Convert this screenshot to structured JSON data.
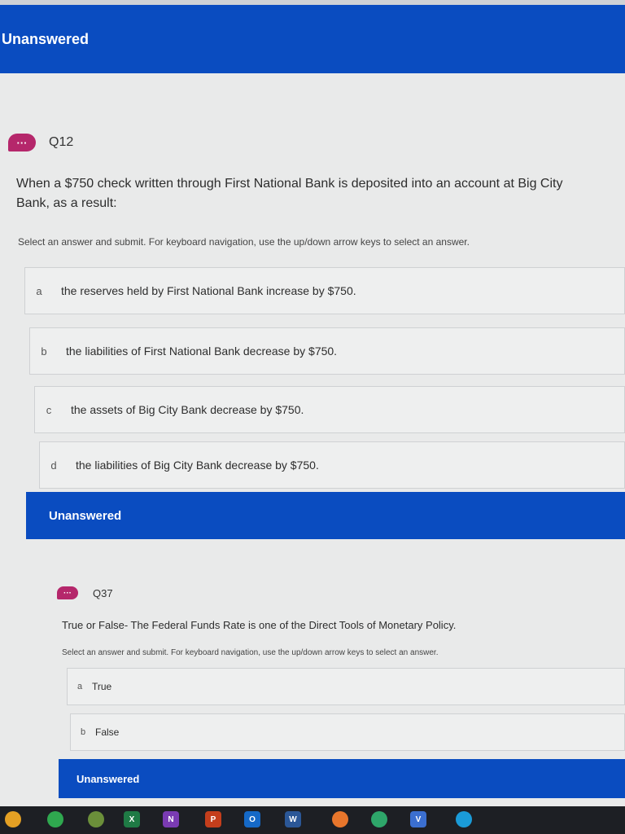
{
  "status": {
    "unanswered": "Unanswered"
  },
  "q12": {
    "number": "Q12",
    "badge": "···",
    "text": "When a $750 check written through First National Bank is deposited into an account at Big City Bank, as a result:",
    "instruction": "Select an answer and submit. For keyboard navigation, use the up/down arrow keys to select an answer.",
    "choices": [
      {
        "letter": "a",
        "text": "the reserves held by First National Bank increase by $750."
      },
      {
        "letter": "b",
        "text": "the liabilities of First National Bank decrease by $750."
      },
      {
        "letter": "c",
        "text": "the assets of Big City Bank decrease by $750."
      },
      {
        "letter": "d",
        "text": "the liabilities of Big City Bank decrease by $750."
      }
    ]
  },
  "q37": {
    "number": "Q37",
    "badge": "···",
    "text": "True or False- The Federal Funds Rate is one of the Direct Tools of Monetary Policy.",
    "instruction": "Select an answer and submit. For keyboard navigation, use the up/down arrow keys to select an answer.",
    "choices": [
      {
        "letter": "a",
        "text": "True"
      },
      {
        "letter": "b",
        "text": "False"
      }
    ]
  },
  "taskbar": {
    "icons": [
      {
        "name": "chrome-icon",
        "color": "#e4a024"
      },
      {
        "name": "whatsapp-icon",
        "color": "#2fa84f"
      },
      {
        "name": "minecraft-icon",
        "color": "#6b8f3a"
      },
      {
        "name": "excel-icon",
        "color": "#1f7a45",
        "label": "X"
      },
      {
        "name": "onenote-icon",
        "color": "#7a3bb3",
        "label": "N"
      },
      {
        "name": "powerpoint-icon",
        "color": "#c43e1c",
        "label": "P"
      },
      {
        "name": "outlook-icon",
        "color": "#1569c7",
        "label": "O"
      },
      {
        "name": "word-icon",
        "color": "#2b5797",
        "label": "W"
      },
      {
        "name": "paint-icon",
        "color": "#e8762c"
      },
      {
        "name": "teams-icon",
        "color": "#2ea66a"
      },
      {
        "name": "visio-icon",
        "color": "#3b6fd0",
        "label": "V"
      },
      {
        "name": "edge-icon",
        "color": "#1a9bd8"
      }
    ]
  }
}
